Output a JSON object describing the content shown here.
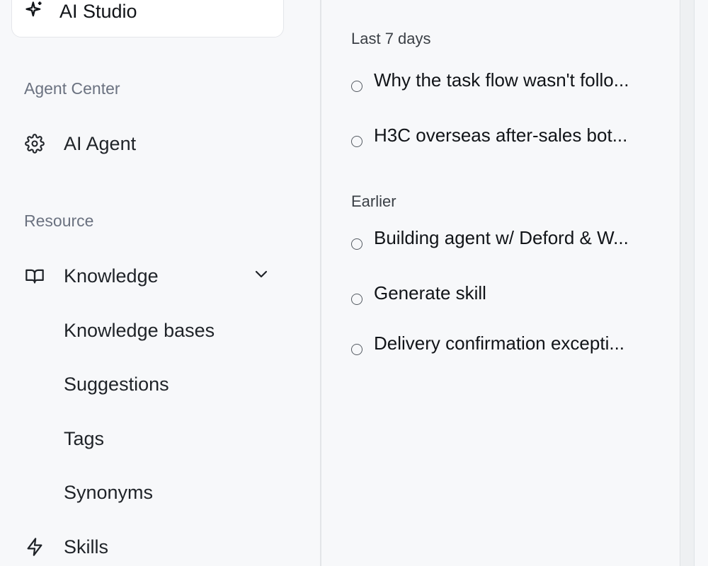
{
  "sidebar": {
    "studio": {
      "label": "AI Studio",
      "icon": "sparkle-icon"
    },
    "agent_center": {
      "title": "Agent Center",
      "items": [
        {
          "label": "AI Agent",
          "icon": "gear-icon"
        }
      ]
    },
    "resource": {
      "title": "Resource",
      "knowledge": {
        "label": "Knowledge",
        "icon": "book-icon",
        "expanded": true,
        "children": [
          "Knowledge bases",
          "Suggestions",
          "Tags",
          "Synonyms"
        ]
      },
      "skills": {
        "label": "Skills",
        "icon": "lightning-icon"
      }
    }
  },
  "history": {
    "groups": [
      {
        "title": "Last 7 days",
        "items": [
          "Why the task flow wasn't follo...",
          "H3C overseas after-sales bot..."
        ]
      },
      {
        "title": "Earlier",
        "items": [
          "Building agent w/ Deford & W...",
          "Generate skill",
          "Delivery confirmation excepti..."
        ]
      }
    ]
  }
}
